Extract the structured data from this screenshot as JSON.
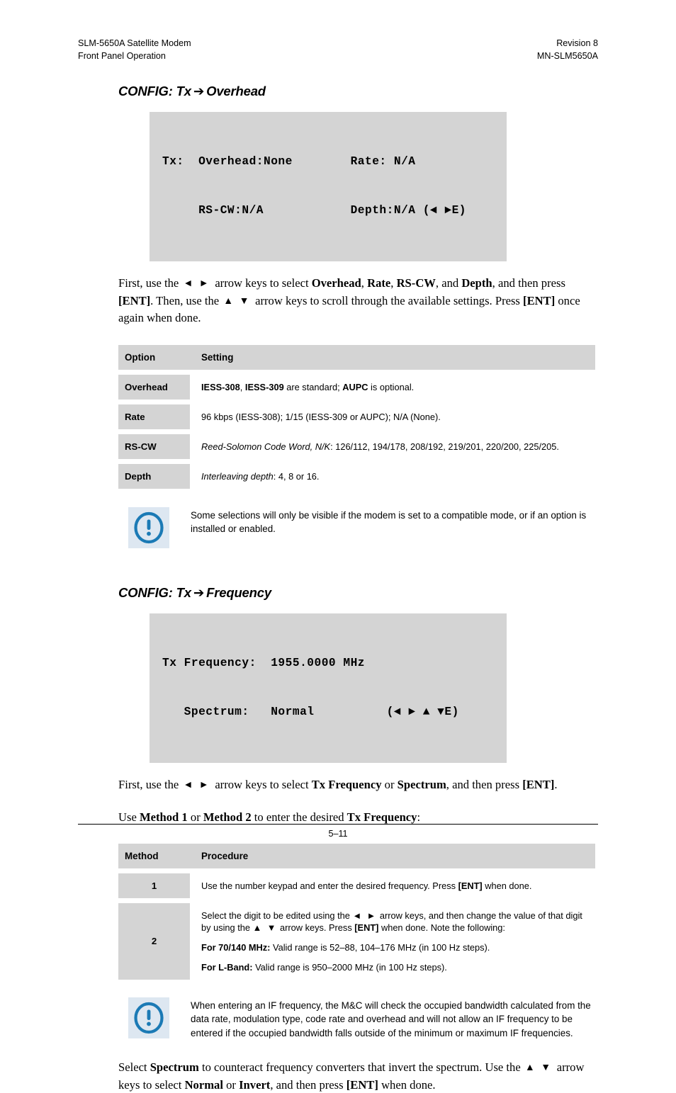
{
  "header": {
    "left_line1": "SLM-5650A Satellite Modem",
    "left_line2": "Front Panel Operation",
    "right_line1": "Revision 8",
    "right_line2": "MN-SLM5650A"
  },
  "section_overhead": {
    "title_prefix": "CONFIG: Tx",
    "title_arrow": "➔",
    "title_suffix": "Overhead",
    "lcd_line1": "Tx:  Overhead:None        Rate: N/A",
    "lcd_line2": "     RS-CW:N/A            Depth:N/A (◄ ►E)",
    "intro_1": "First, use the",
    "intro_keys_lr": "◄ ►",
    "intro_2": "arrow keys to select",
    "intro_b1": "Overhead",
    "intro_sep1": ",",
    "intro_b2": "Rate",
    "intro_sep2": ",",
    "intro_b3": "RS-CW",
    "intro_sep3": ", and",
    "intro_b4": "Depth",
    "intro_3": ", and then press",
    "intro_b5": "[ENT]",
    "intro_4": ". Then, use the",
    "intro_keys_ud": "▲ ▼",
    "intro_5": "arrow keys to scroll through the available settings. Press",
    "intro_b6": "[ENT]",
    "intro_6": "once again when done."
  },
  "table_overhead": {
    "headers": [
      "Option",
      "Setting"
    ],
    "rows": [
      {
        "option": "Overhead",
        "setting_parts": [
          {
            "text": "IESS-308",
            "style": "bold"
          },
          {
            "text": ", ",
            "style": "normal"
          },
          {
            "text": "IESS-309",
            "style": "bold"
          },
          {
            "text": " are standard; ",
            "style": "normal"
          },
          {
            "text": "AUPC",
            "style": "bold"
          },
          {
            "text": " is optional.",
            "style": "normal"
          }
        ]
      },
      {
        "option": "Rate",
        "setting_parts": [
          {
            "text": "96 kbps (IESS-308); 1/15 (IESS-309 or AUPC); N/A (None).",
            "style": "normal"
          }
        ]
      },
      {
        "option": "RS-CW",
        "setting_parts": [
          {
            "text": "Reed-Solomon Code Word, N/K",
            "style": "italic"
          },
          {
            "text": ": 126/112, 194/178, 208/192, 219/201, 220/200, 225/205.",
            "style": "normal"
          }
        ]
      },
      {
        "option": "Depth",
        "setting_parts": [
          {
            "text": "Interleaving depth",
            "style": "italic"
          },
          {
            "text": ": 4, 8 or 16.",
            "style": "normal"
          }
        ]
      }
    ]
  },
  "note_overhead": {
    "icon": "exclamation-circle-icon",
    "text": "Some selections will only be visible if the modem is set to a compatible mode, or if an option is installed or enabled."
  },
  "section_frequency": {
    "title_prefix": "CONFIG: Tx",
    "title_arrow": "➔",
    "title_suffix": "Frequency",
    "lcd_line1": "Tx Frequency:  1955.0000 MHz",
    "lcd_line2": "   Spectrum:   Normal          (◄ ► ▲ ▼E)",
    "intro_1": "First, use the",
    "intro_keys_lr": "◄ ►",
    "intro_2": "arrow keys to select",
    "intro_b1": "Tx Frequency",
    "intro_3": "or",
    "intro_b2": "Spectrum",
    "intro_4": ", and then press",
    "intro_b3": "[ENT]",
    "intro_5": ".",
    "method_1": "Use",
    "method_b1": "Method 1",
    "method_2": "or",
    "method_b2": "Method 2",
    "method_3": "to enter the desired",
    "method_b3": "Tx Frequency",
    "method_4": ":"
  },
  "table_method": {
    "headers": [
      "Method",
      "Procedure"
    ],
    "rows": [
      {
        "method": "1",
        "paragraphs": [
          [
            {
              "text": "Use the number keypad and enter the desired frequency. Press ",
              "style": "normal"
            },
            {
              "text": "[ENT]",
              "style": "bold"
            },
            {
              "text": " when done.",
              "style": "normal"
            }
          ]
        ]
      },
      {
        "method": "2",
        "paragraphs": [
          [
            {
              "text": "Select the digit to be edited using the ",
              "style": "normal"
            },
            {
              "text": "◄ ►",
              "style": "keys"
            },
            {
              "text": " arrow keys, and then change the value of that digit by using the ",
              "style": "normal"
            },
            {
              "text": "▲ ▼",
              "style": "keys"
            },
            {
              "text": " arrow keys. Press ",
              "style": "normal"
            },
            {
              "text": "[ENT]",
              "style": "bold"
            },
            {
              "text": " when done. Note the following:",
              "style": "normal"
            }
          ],
          [
            {
              "text": "For 70/140 MHz:",
              "style": "bold"
            },
            {
              "text": " Valid range is 52–88, 104–176 MHz (in 100 Hz steps).",
              "style": "normal"
            }
          ],
          [
            {
              "text": "For L-Band:",
              "style": "bold"
            },
            {
              "text": " Valid range is 950–2000 MHz (in 100 Hz steps).",
              "style": "normal"
            }
          ]
        ]
      }
    ]
  },
  "note_frequency": {
    "icon": "exclamation-circle-icon",
    "text": "When entering an IF frequency, the M&C will check the occupied bandwidth calculated from the data rate, modulation type, code rate and overhead and will not allow an IF frequency to be entered if the occupied bandwidth falls outside of the minimum or maximum IF frequencies."
  },
  "closing": {
    "p1": "Select",
    "b1": "Spectrum",
    "p2": "to counteract frequency converters that invert the spectrum. Use the",
    "keys_ud": "▲ ▼",
    "p3": "arrow keys to select",
    "b2": "Normal",
    "p4": "or",
    "b3": "Invert",
    "p5": ", and then press",
    "b4": "[ENT]",
    "p6": "when done."
  },
  "footer": {
    "page_number": "5–11"
  },
  "colors": {
    "panel_gray": "#d4d4d4",
    "note_icon_bg": "#dde7f1",
    "note_icon_blue": "#1b7ab5",
    "text": "#000000"
  }
}
